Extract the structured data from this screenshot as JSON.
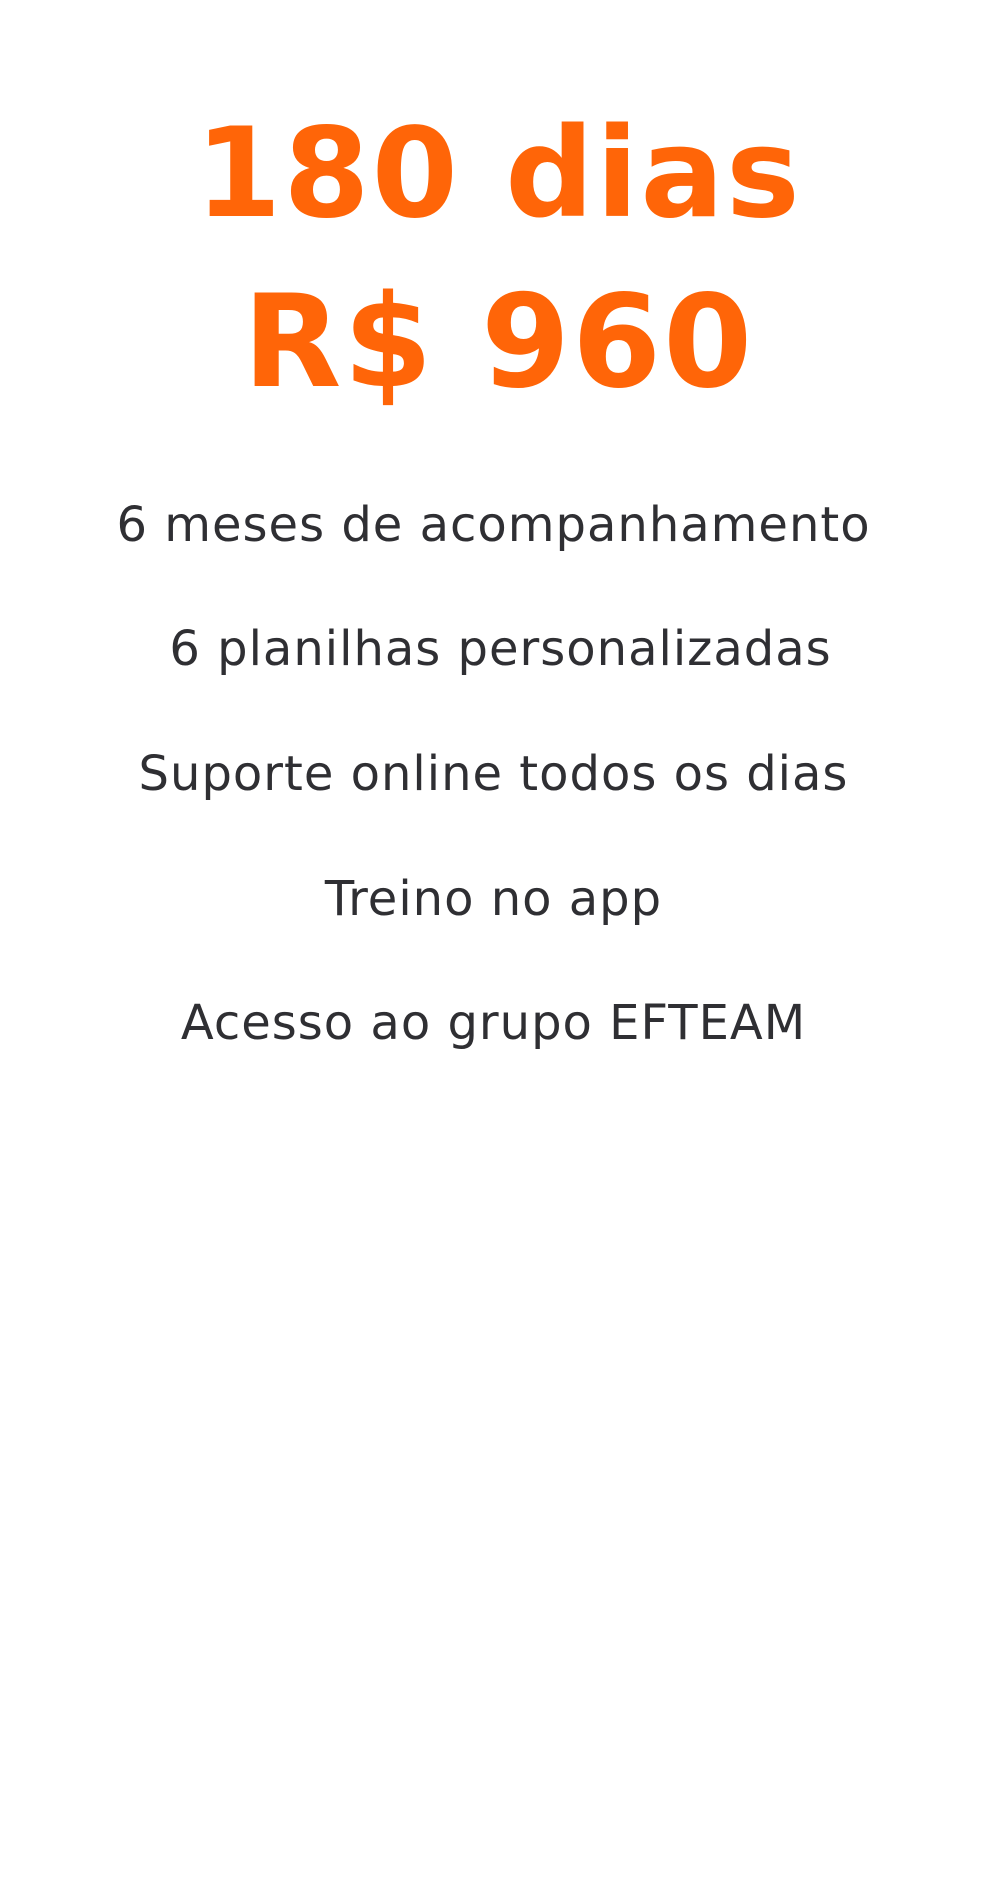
{
  "offer": {
    "duration": "180 dias",
    "price": "R$ 960"
  },
  "features": [
    "6 meses de acompanhamento",
    "6 planilhas personalizadas",
    "Suporte online todos os dias",
    "Treino no app",
    "Acesso ao grupo EFTEAM"
  ],
  "colors": {
    "accent": "#ff6508",
    "text": "#2f2f33",
    "background": "#ffffff"
  }
}
